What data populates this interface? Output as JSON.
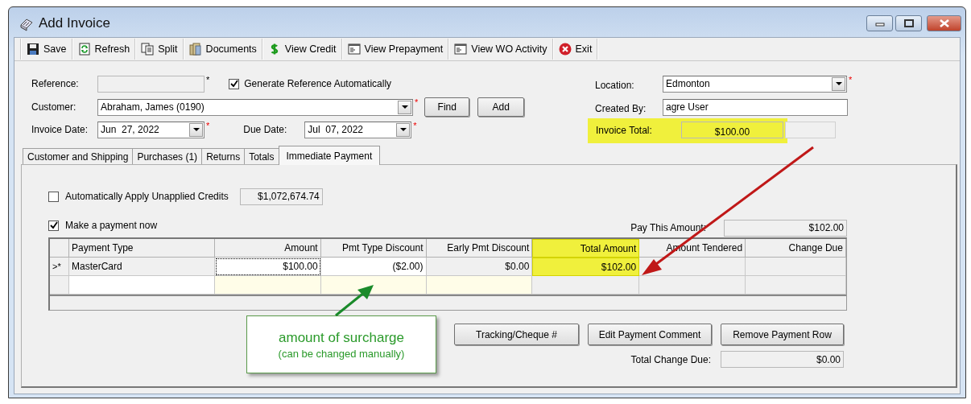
{
  "window": {
    "title": "Add Invoice"
  },
  "toolbar": [
    {
      "label": "Save"
    },
    {
      "label": "Refresh"
    },
    {
      "label": "Split"
    },
    {
      "label": "Documents"
    },
    {
      "label": "View Credit"
    },
    {
      "label": "View Prepayment"
    },
    {
      "label": "View WO Activity"
    },
    {
      "label": "Exit"
    }
  ],
  "header": {
    "reference": {
      "label": "Reference:",
      "marker": "*"
    },
    "generate_reference": {
      "label": "Generate Reference Automatically",
      "checked": true
    },
    "customer": {
      "label": "Customer:",
      "value": "Abraham, James (0190)",
      "marker": "*"
    },
    "customer_buttons": [
      "Find",
      "Add"
    ],
    "invoice_date": {
      "label": "Invoice Date:",
      "value": "Jun  27, 2022",
      "marker": "*"
    },
    "due_date": {
      "label": "Due Date:",
      "value": "Jul  07, 2022",
      "marker": "*"
    },
    "location": {
      "label": "Location:",
      "value": "Edmonton",
      "marker": "*"
    },
    "created_by": {
      "label": "Created By:",
      "value": "agre User"
    },
    "invoice_total": {
      "label": "Invoice Total:",
      "value": "$100.00",
      "highlighted": true
    }
  },
  "tabs": [
    {
      "label": "Customer and Shipping",
      "selected": false
    },
    {
      "label": "Purchases (1)",
      "selected": false
    },
    {
      "label": "Returns",
      "selected": false
    },
    {
      "label": "Totals",
      "selected": false
    },
    {
      "label": "Immediate Payment",
      "selected": true
    }
  ],
  "payment": {
    "auto_apply": {
      "label": "Automatically Apply Unapplied Credits",
      "checked": false,
      "value": "$1,072,674.74"
    },
    "make_payment": {
      "label": "Make a payment now",
      "checked": true
    },
    "pay_this_amount": {
      "label": "Pay This Amount:",
      "value": "$102.00"
    },
    "grid": {
      "columns": [
        {
          "label": "Payment Type",
          "highlighted": false
        },
        {
          "label": "Amount",
          "highlighted": false
        },
        {
          "label": "Pmt Type Discount",
          "highlighted": false
        },
        {
          "label": "Early Pmt Discount",
          "highlighted": false
        },
        {
          "label": "Total Amount",
          "highlighted": true
        },
        {
          "label": "Amount Tendered",
          "highlighted": false
        },
        {
          "label": "Change Due",
          "highlighted": false
        }
      ],
      "rows": [
        {
          "indicator": ">*",
          "cells": [
            {
              "text": "MasterCard",
              "focused": false
            },
            {
              "text": "$100.00",
              "focused": true
            },
            {
              "text": "($2.00)",
              "focused": false
            },
            {
              "text": "$0.00",
              "focused": false
            },
            {
              "text": "$102.00",
              "focused": false
            }
          ]
        }
      ]
    },
    "buttons": [
      "Tracking/Cheque #",
      "Edit Payment Comment",
      "Remove Payment Row"
    ],
    "total_change_due": {
      "label": "Total Change Due:",
      "value": "$0.00"
    }
  },
  "annotation": {
    "title": "amount of surcharge",
    "note": "(can be changed manually)"
  }
}
